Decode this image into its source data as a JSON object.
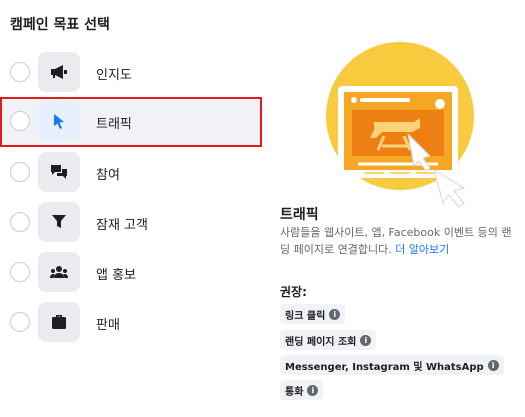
{
  "page_title": "캠페인 목표 선택",
  "options": [
    {
      "label": "인지도",
      "icon": "megaphone-icon"
    },
    {
      "label": "트래픽",
      "icon": "cursor-icon"
    },
    {
      "label": "참여",
      "icon": "chat-bubbles-icon"
    },
    {
      "label": "잠재 고객",
      "icon": "funnel-icon"
    },
    {
      "label": "앱 홍보",
      "icon": "people-icon"
    },
    {
      "label": "판매",
      "icon": "briefcase-icon"
    }
  ],
  "selected_option": "트래픽",
  "detail": {
    "title": "트래픽",
    "description": "사람들을 웹사이트, 앱, Facebook 이벤트 등의 랜딩 페이지로 연결합니다.",
    "learn_more": "더 알아보기",
    "recommended_label": "권장:",
    "recommendations": [
      "링크 클릭",
      "랜딩 페이지 조회",
      "Messenger, Instagram 및 WhatsApp",
      "통화"
    ],
    "info_icon_glyph": "i"
  },
  "colors": {
    "highlight_border": "#e51b1b",
    "link": "#1877f2",
    "selected_icon": "#1877f2",
    "illustration_orange": "#f5a623"
  }
}
